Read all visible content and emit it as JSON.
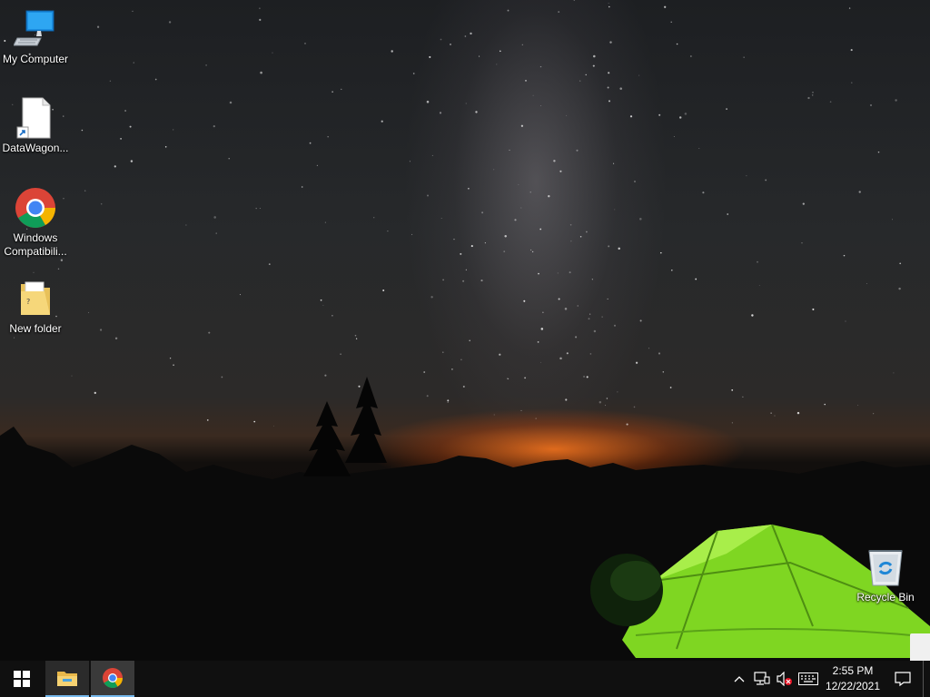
{
  "desktop": {
    "icons": [
      {
        "label": "My Computer",
        "icon": "my-computer-icon"
      },
      {
        "label": "DataWagon...",
        "icon": "shortcut-file-icon"
      },
      {
        "label": "Windows Compatibili...",
        "icon": "chrome-icon"
      },
      {
        "label": "New folder",
        "icon": "folder-icon"
      },
      {
        "label": "Recycle Bin",
        "icon": "recycle-bin-icon"
      }
    ]
  },
  "taskbar": {
    "start": "windows-start-icon",
    "pinned": [
      {
        "name": "File Explorer",
        "icon": "folder-icon"
      },
      {
        "name": "Google Chrome",
        "icon": "chrome-icon"
      }
    ],
    "tray": {
      "icons": [
        "chevron-up-icon",
        "network-icon",
        "volume-muted-icon",
        "keyboard-icon"
      ],
      "time": "2:55 PM",
      "date": "12/22/2021",
      "notifications": "notification-icon"
    },
    "accent": "#76b9ed",
    "background": "#101010"
  }
}
